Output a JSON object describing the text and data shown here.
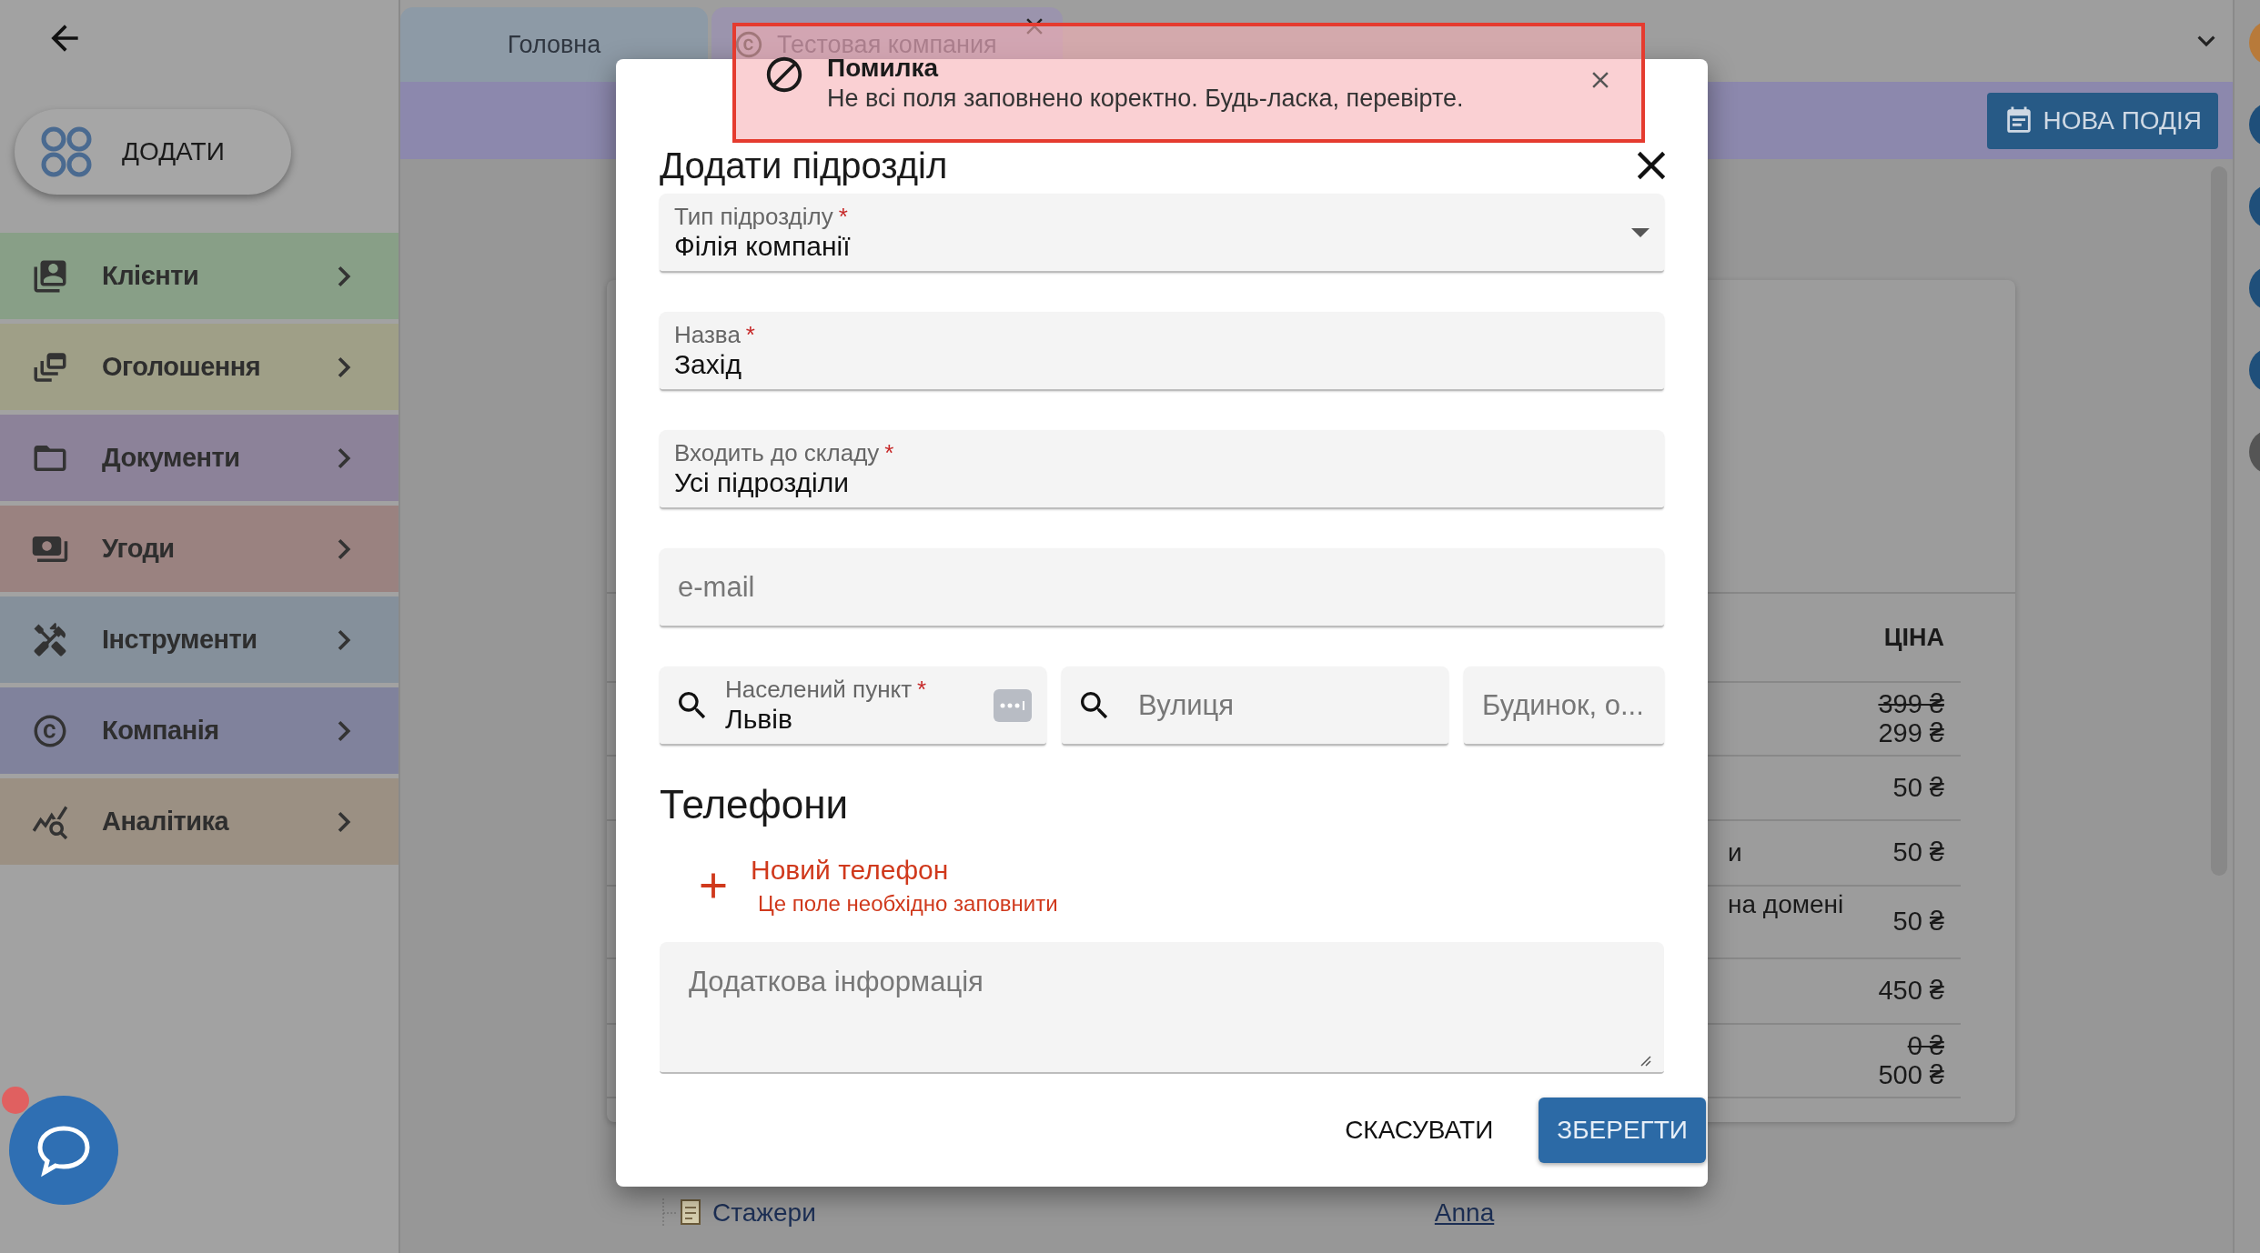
{
  "sidebar": {
    "add_button": "ДОДАТИ",
    "items": [
      {
        "label": "Клієнти",
        "color": "#889f87"
      },
      {
        "label": "Оголошення",
        "color": "#9f9f87"
      },
      {
        "label": "Документи",
        "color": "#8c8299"
      },
      {
        "label": "Угоди",
        "color": "#9a8280"
      },
      {
        "label": "Інструменти",
        "color": "#85909b"
      },
      {
        "label": "Компанія",
        "color": "#80829c"
      },
      {
        "label": "Аналітика",
        "color": "#9b9083"
      }
    ]
  },
  "tabs": [
    {
      "label": "Головна",
      "selected": false
    },
    {
      "label": "Тестовая компания",
      "selected": true
    }
  ],
  "toolbar": {
    "new_event_button": "НОВА ПОДІЯ"
  },
  "price_table": {
    "header": "ЦІНА",
    "rows": [
      {
        "old_price": "399 ₴",
        "price": "299 ₴"
      },
      {
        "price": "50 ₴"
      },
      {
        "label": "и",
        "price": "50 ₴"
      },
      {
        "label": "на домені",
        "price": "50 ₴"
      },
      {
        "price": "450 ₴"
      },
      {
        "old_price": "0 ₴",
        "price": "500 ₴"
      }
    ]
  },
  "tree_item": {
    "label": "Стажери",
    "link": "Anna"
  },
  "dialog": {
    "title": "Додати підрозділ",
    "fields": [
      {
        "kind": "select",
        "label": "Тип підрозділу",
        "required_mark": "*",
        "value": "Філія компанії"
      },
      {
        "kind": "text",
        "label": "Назва",
        "required_mark": "*",
        "value": "Захід"
      },
      {
        "kind": "text",
        "label": "Входить до складу",
        "required_mark": "*",
        "value": "Усі підрозділи"
      },
      {
        "kind": "text",
        "placeholder": "e-mail"
      }
    ],
    "address": [
      {
        "kind": "search",
        "label": "Населений пункт",
        "required_mark": "*",
        "value": "Львів",
        "has_more_button": true
      },
      {
        "kind": "search",
        "placeholder": "Вулиця"
      },
      {
        "kind": "text",
        "placeholder": "Будинок, о..."
      }
    ],
    "phones_heading": "Телефони",
    "new_phone": "Новий телефон",
    "phone_error": "Це поле необхідно заповнити",
    "notes_placeholder": "Додаткова інформація",
    "buttons": [
      {
        "kind": "text",
        "label": "СКАСУВАТИ"
      },
      {
        "kind": "primary",
        "label": "ЗБЕРЕГТИ"
      }
    ]
  },
  "toast": {
    "title": "Помилка",
    "message": "Не всі поля заповнено коректно. Будь-ласка, перевірте."
  }
}
